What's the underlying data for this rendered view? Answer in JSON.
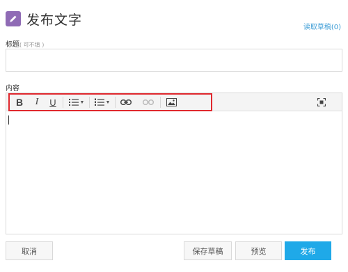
{
  "header": {
    "icon": "pencil-icon",
    "title": "发布文字",
    "drafts_link": "读取草稿(0)"
  },
  "title_field": {
    "label": "标题",
    "hint": "( 可不填 )",
    "value": "",
    "placeholder": ""
  },
  "content_field": {
    "label": "内容",
    "value": ""
  },
  "toolbar": {
    "bold_label": "B",
    "italic_label": "I",
    "underline_label": "U",
    "buttons": [
      "bold-icon",
      "italic-icon",
      "underline-icon",
      "bullet-list-icon",
      "numbered-list-icon",
      "link-icon",
      "unlink-icon",
      "image-icon",
      "fullscreen-icon"
    ]
  },
  "buttons": {
    "cancel": "取消",
    "save_draft": "保存草稿",
    "preview": "预览",
    "publish": "发布"
  },
  "colors": {
    "accent": "#1fa9e8",
    "header_icon": "#8f6bb5",
    "link": "#3a9bd5",
    "highlight": "#e0282e"
  }
}
